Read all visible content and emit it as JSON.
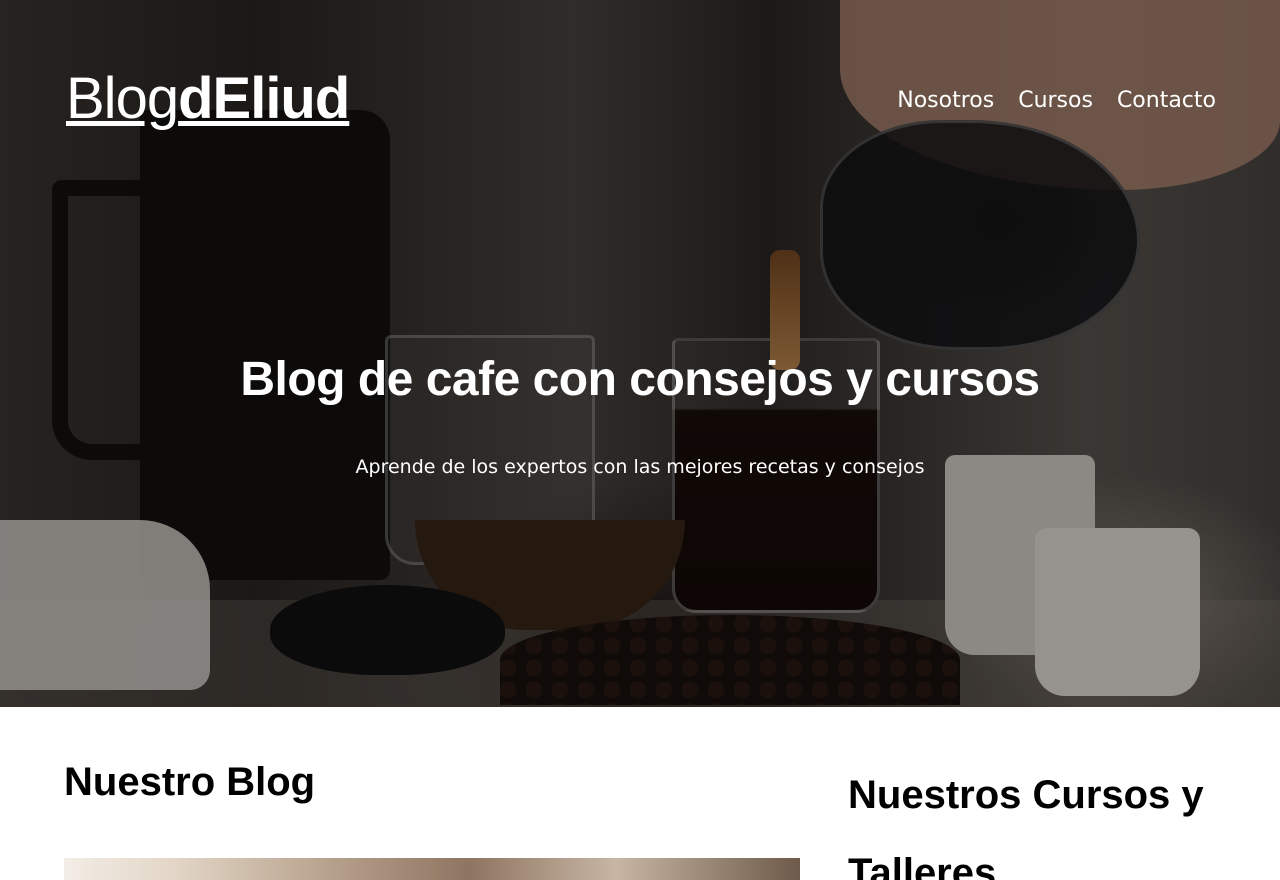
{
  "header": {
    "logo_light": "Blog",
    "logo_bold": "dEliud",
    "nav": [
      {
        "label": "Nosotros"
      },
      {
        "label": "Cursos"
      },
      {
        "label": "Contacto"
      }
    ]
  },
  "hero": {
    "title": "Blog de cafe con consejos y cursos",
    "subtitle": "Aprende de los expertos con las mejores recetas y consejos"
  },
  "main": {
    "blog_heading": "Nuestro Blog",
    "courses_heading": "Nuestros Cursos y Talleres"
  }
}
